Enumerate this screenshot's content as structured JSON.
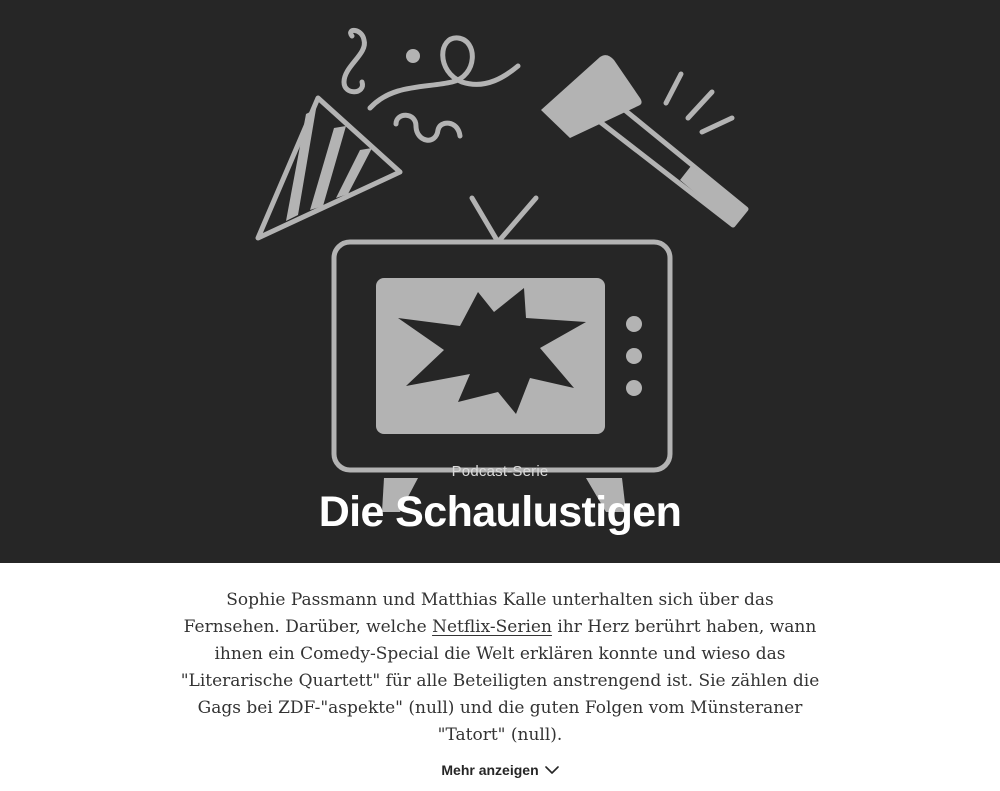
{
  "hero": {
    "kicker": "Podcast-Serie",
    "title": "Die Schaulustigen",
    "illustration": {
      "icons": [
        "party-hat-icon",
        "confetti-icon",
        "hammer-icon",
        "broken-tv-icon"
      ],
      "background_color": "#262626",
      "art_color": "#b3b3b3"
    }
  },
  "description": {
    "part1": "Sophie Passmann und Matthias Kalle unterhalten sich über das Fernsehen. Darüber, welche ",
    "link": "Netflix-Serien",
    "part2": " ihr Herz berührt haben, wann ihnen ein Comedy-Special die Welt erklären konnte und wieso das \"Literarische Quartett\" für alle Beteiligten anstrengend ist. Sie zählen die Gags bei ZDF-\"aspekte\" (null) und die guten Folgen vom Münsteraner \"Tatort\" (null)."
  },
  "more": {
    "label": "Mehr anzeigen",
    "icon": "chevron-down-icon"
  }
}
